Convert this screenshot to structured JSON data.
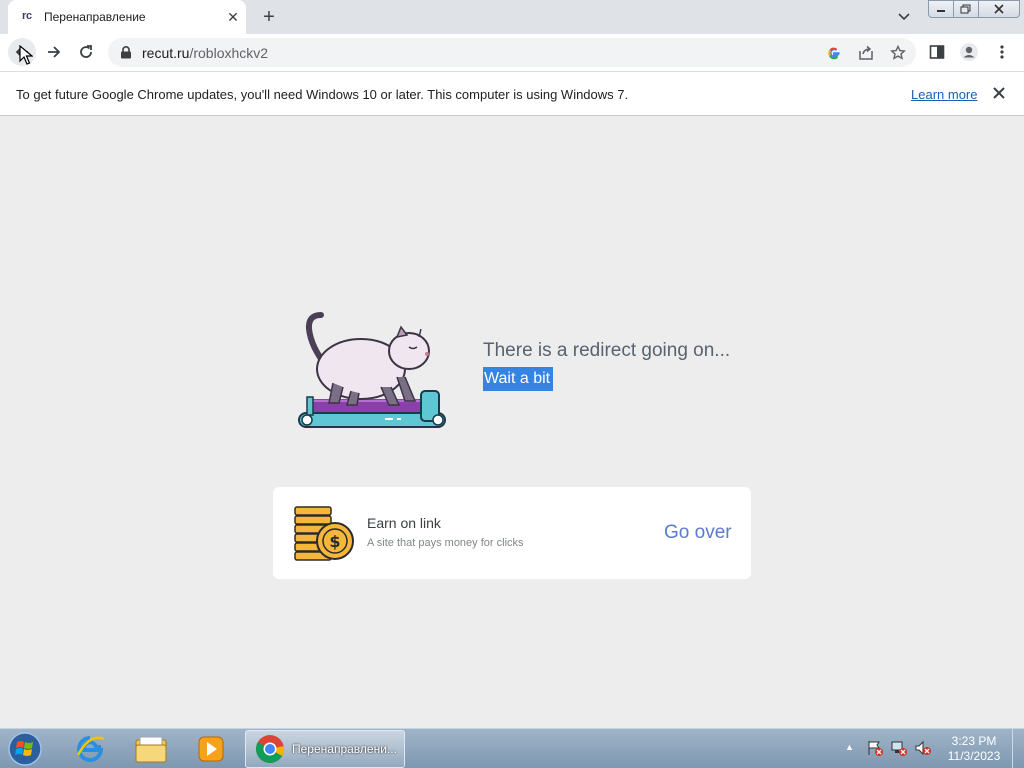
{
  "browser": {
    "tab": {
      "favicon": "rc",
      "title": "Перенаправление",
      "close": "✕"
    },
    "new_tab": "+",
    "url_host": "recut.ru",
    "url_path": "/robloxhckv2"
  },
  "infobar": {
    "message": "To get future Google Chrome updates, you'll need Windows 10 or later. This computer is using Windows 7.",
    "link": "Learn more"
  },
  "page": {
    "redirect_title": "There is a redirect going on...",
    "redirect_sub": "Wait a bit",
    "card": {
      "title": "Earn on link",
      "subtitle": "A site that pays money for clicks",
      "button": "Go over"
    }
  },
  "taskbar": {
    "chrome_label": "Перенаправлени...",
    "time": "3:23 PM",
    "date": "11/3/2023"
  },
  "icons": [
    "back-arrow-icon",
    "forward-arrow-icon",
    "reload-icon",
    "lock-icon",
    "google-icon",
    "share-icon",
    "star-icon",
    "side-panel-icon",
    "profile-icon",
    "menu-icon",
    "close-icon",
    "cat-treadmill-illustration",
    "coins-icon",
    "windows-start-icon",
    "internet-explorer-icon",
    "file-explorer-icon",
    "media-player-icon",
    "chrome-icon"
  ],
  "colors": {
    "selection": "#3584e4",
    "link": "#5b7bd0",
    "page_bg": "#ededed"
  }
}
